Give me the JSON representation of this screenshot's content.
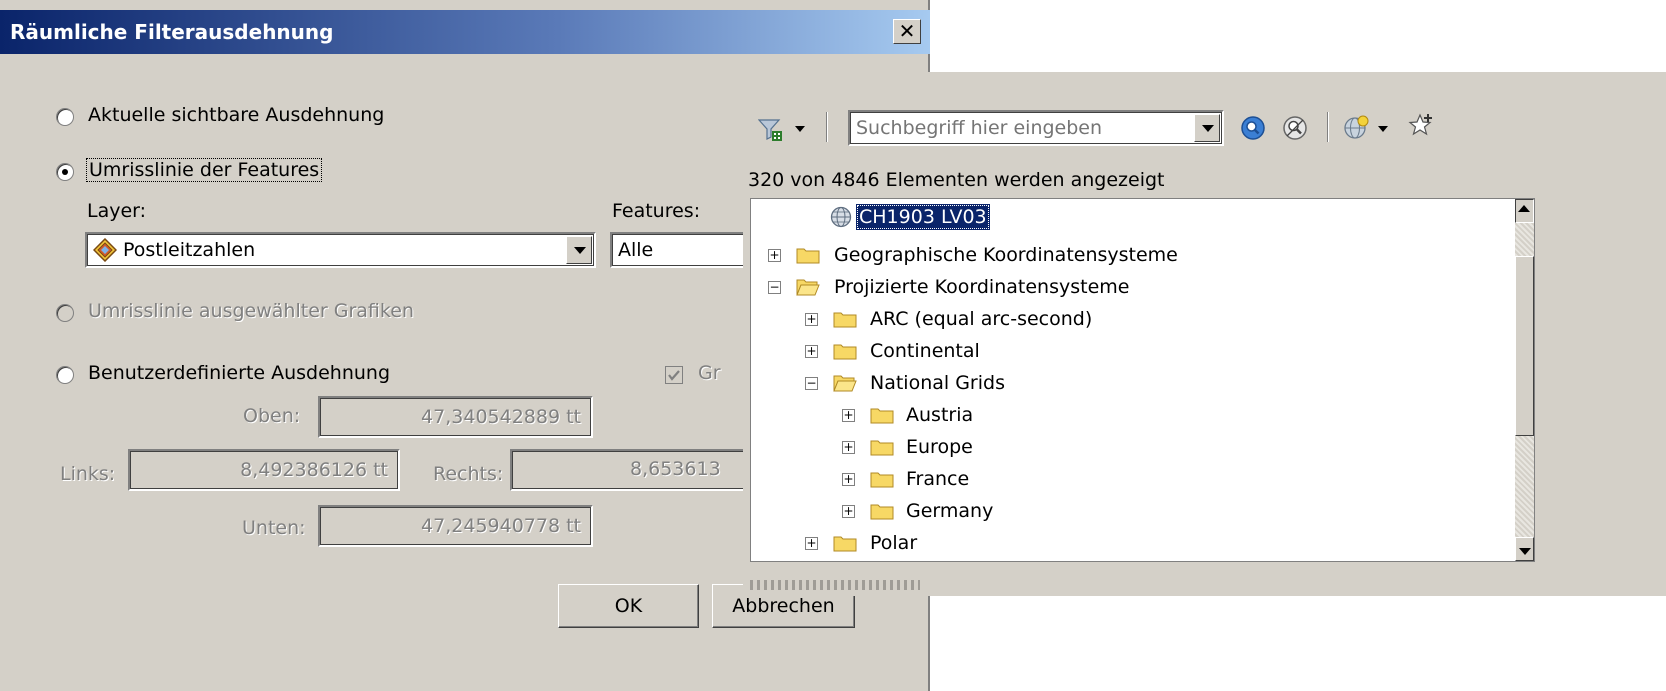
{
  "dialog": {
    "title": "Räumliche Filterausdehnung",
    "close_label": "✕",
    "options": {
      "current_extent_label": "Aktuelle sichtbare Ausdehnung",
      "feature_outline_label": "Umrisslinie der Features",
      "graphics_outline_label": "Umrisslinie ausgewählter Grafiken",
      "custom_extent_label": "Benutzerdefinierte Ausdehnung"
    },
    "layer_label": "Layer:",
    "features_label": "Features:",
    "layer_value": "Postleitzahlen",
    "features_value": "Alle",
    "graphics_checkbox_label": "Gr",
    "top_label": "Oben:",
    "top_value": "47,340542889 tt",
    "left_label": "Links:",
    "left_value": "8,492386126 tt",
    "right_label": "Rechts:",
    "right_value": "8,653613",
    "bottom_label": "Unten:",
    "bottom_value": "47,245940778 tt",
    "ok_label": "OK",
    "cancel_label": "Abbrechen"
  },
  "panel": {
    "search_placeholder": "Suchbegriff hier eingeben",
    "count_text": "320 von 4846 Elementen werden angezeigt",
    "tree": [
      {
        "label": "CH1903 LV03",
        "icon": "globe-icon",
        "selected": true
      },
      {
        "label": "Geographische Koordinatensysteme",
        "icon": "folder-icon",
        "expanded": false
      },
      {
        "label": "Projizierte Koordinatensysteme",
        "icon": "folder-open-icon",
        "expanded": true
      },
      {
        "label": "ARC (equal arc-second)",
        "icon": "folder-icon",
        "expanded": false
      },
      {
        "label": "Continental",
        "icon": "folder-icon",
        "expanded": false
      },
      {
        "label": "National Grids",
        "icon": "folder-open-icon",
        "expanded": true
      },
      {
        "label": "Austria",
        "icon": "folder-icon",
        "expanded": false
      },
      {
        "label": "Europe",
        "icon": "folder-icon",
        "expanded": false
      },
      {
        "label": "France",
        "icon": "folder-icon",
        "expanded": false
      },
      {
        "label": "Germany",
        "icon": "folder-icon",
        "expanded": false
      },
      {
        "label": "Polar",
        "icon": "folder-icon",
        "expanded": false
      }
    ]
  }
}
